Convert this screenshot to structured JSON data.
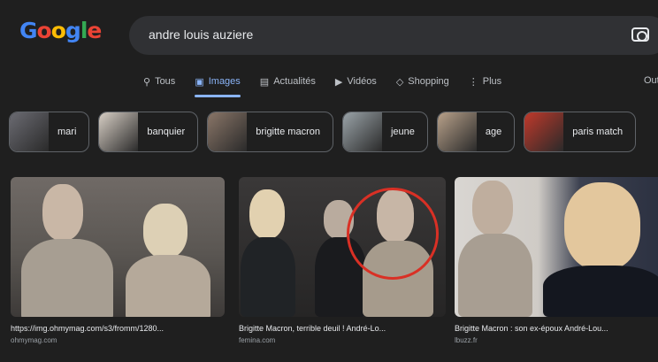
{
  "logo": {
    "letters": [
      "G",
      "o",
      "o",
      "g",
      "l",
      "e"
    ],
    "colors": [
      "#4285f4",
      "#ea4335",
      "#fbbc05",
      "#4285f4",
      "#34a853",
      "#ea4335"
    ]
  },
  "search": {
    "query": "andre louis auziere",
    "camera_icon": "camera-icon"
  },
  "tabs": [
    {
      "label": "Tous",
      "icon": "search-icon",
      "glyph": "⚲",
      "active": false
    },
    {
      "label": "Images",
      "icon": "image-icon",
      "glyph": "▣",
      "active": true
    },
    {
      "label": "Actualités",
      "icon": "news-icon",
      "glyph": "▤",
      "active": false
    },
    {
      "label": "Vidéos",
      "icon": "video-icon",
      "glyph": "▶",
      "active": false
    },
    {
      "label": "Shopping",
      "icon": "tag-icon",
      "glyph": "◇",
      "active": false
    },
    {
      "label": "Plus",
      "icon": "more-icon",
      "glyph": "⋮",
      "active": false
    }
  ],
  "tools_label": "Outils",
  "chips": [
    {
      "label": "mari",
      "thumb_color": "#6b6b72"
    },
    {
      "label": "banquier",
      "thumb_color": "#d8cfc5"
    },
    {
      "label": "brigitte macron",
      "thumb_color": "#8a7668"
    },
    {
      "label": "jeune",
      "thumb_color": "#9aa3a8"
    },
    {
      "label": "age",
      "thumb_color": "#b8a18a"
    },
    {
      "label": "paris match",
      "thumb_color": "#c0392b"
    }
  ],
  "results": [
    {
      "caption": "https://img.ohmymag.com/s3/fromm/1280...",
      "source": "ohmymag.com"
    },
    {
      "caption": "Brigitte Macron, terrible deuil ! André-Lo...",
      "source": "femina.com"
    },
    {
      "caption": "Brigitte Macron : son ex-époux André-Lou...",
      "source": "lbuzz.fr"
    }
  ]
}
